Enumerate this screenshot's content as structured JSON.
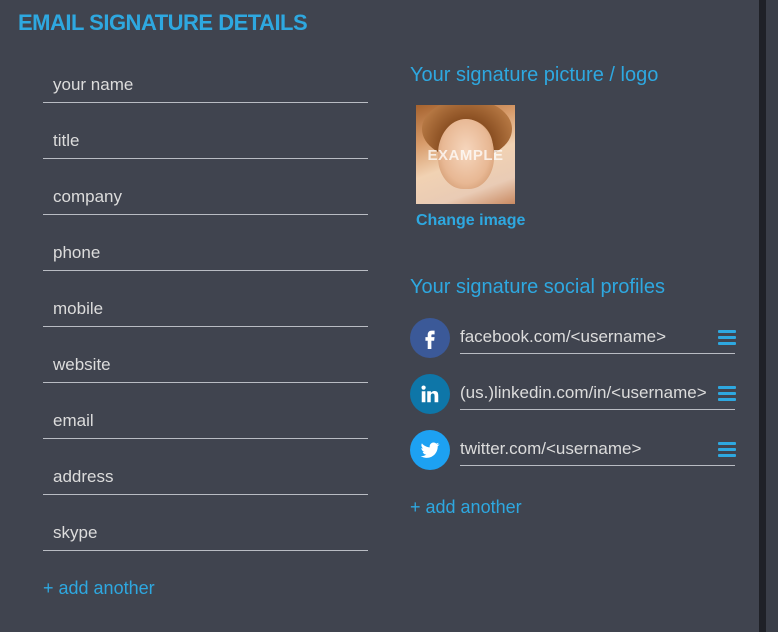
{
  "page": {
    "title": "EMAIL SIGNATURE DETAILS"
  },
  "fields": [
    {
      "name": "name-field",
      "placeholder": "your name"
    },
    {
      "name": "title-field",
      "placeholder": "title"
    },
    {
      "name": "company-field",
      "placeholder": "company"
    },
    {
      "name": "phone-field",
      "placeholder": "phone"
    },
    {
      "name": "mobile-field",
      "placeholder": "mobile"
    },
    {
      "name": "website-field",
      "placeholder": "website"
    },
    {
      "name": "email-field",
      "placeholder": "email"
    },
    {
      "name": "address-field",
      "placeholder": "address"
    },
    {
      "name": "skype-field",
      "placeholder": "skype"
    }
  ],
  "add_field_label": "+ add another",
  "picture": {
    "heading": "Your signature picture / logo",
    "overlay_text": "EXAMPLE",
    "change_label": "Change image"
  },
  "social": {
    "heading": "Your signature social profiles",
    "profiles": [
      {
        "icon": "facebook-icon",
        "placeholder": "facebook.com/<username>",
        "color": "#3b5998"
      },
      {
        "icon": "linkedin-icon",
        "placeholder": "(us.)linkedin.com/in/<username>",
        "color": "#0e76a8"
      },
      {
        "icon": "twitter-icon",
        "placeholder": "twitter.com/<username>",
        "color": "#1da1f2"
      }
    ],
    "add_label": "+ add another"
  },
  "colors": {
    "accent": "#2ea8e0",
    "background": "#40444f"
  }
}
